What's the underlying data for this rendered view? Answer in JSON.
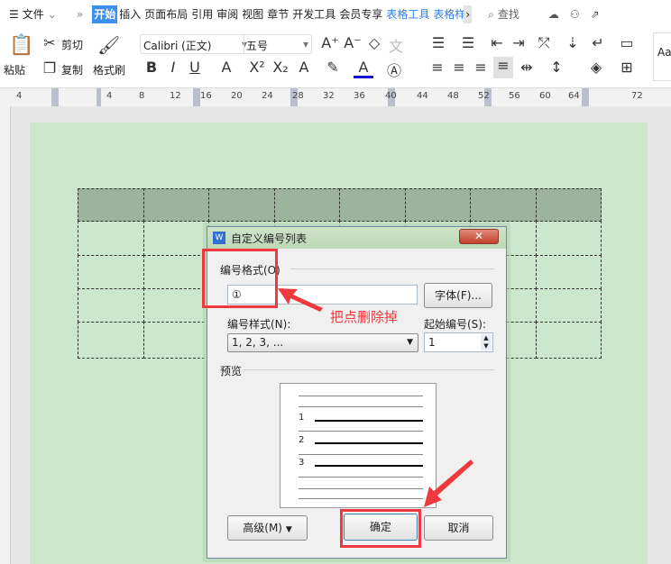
{
  "menubar": {
    "file": "文件",
    "tabs": [
      "开始",
      "插入",
      "页面布局",
      "引用",
      "审阅",
      "视图",
      "章节",
      "开发工具",
      "会员专享",
      "表格工具",
      "表格样"
    ],
    "search": "查找"
  },
  "ribbon": {
    "paste": "粘贴",
    "cut": "剪切",
    "copy": "复制",
    "format_painter": "格式刷",
    "font": "Calibri (正文)",
    "size": "五号",
    "styles_preview": "Aa"
  },
  "ruler": {
    "ticks": [
      "4",
      "4",
      "8",
      "12",
      "16",
      "20",
      "24",
      "28",
      "32",
      "36",
      "40",
      "44",
      "48",
      "52",
      "56",
      "60",
      "64",
      "72"
    ]
  },
  "dialog": {
    "title": "自定义编号列表",
    "format_group": "编号格式(O)",
    "format_value": "①",
    "font_button": "字体(F)...",
    "style_label": "编号样式(N):",
    "style_value": "1, 2, 3, ...",
    "start_label": "起始编号(S):",
    "start_value": "1",
    "preview_label": "预览",
    "preview_numbers": [
      "1",
      "2",
      "3"
    ],
    "advanced": "高级(M)",
    "ok": "确定",
    "cancel": "取消"
  },
  "annotation": {
    "text": "把点删除掉",
    "color": "#f0393f"
  },
  "colors": {
    "page": "#cce8cc",
    "table_header": "#9cb39c",
    "accent": "#3c8ef0"
  }
}
